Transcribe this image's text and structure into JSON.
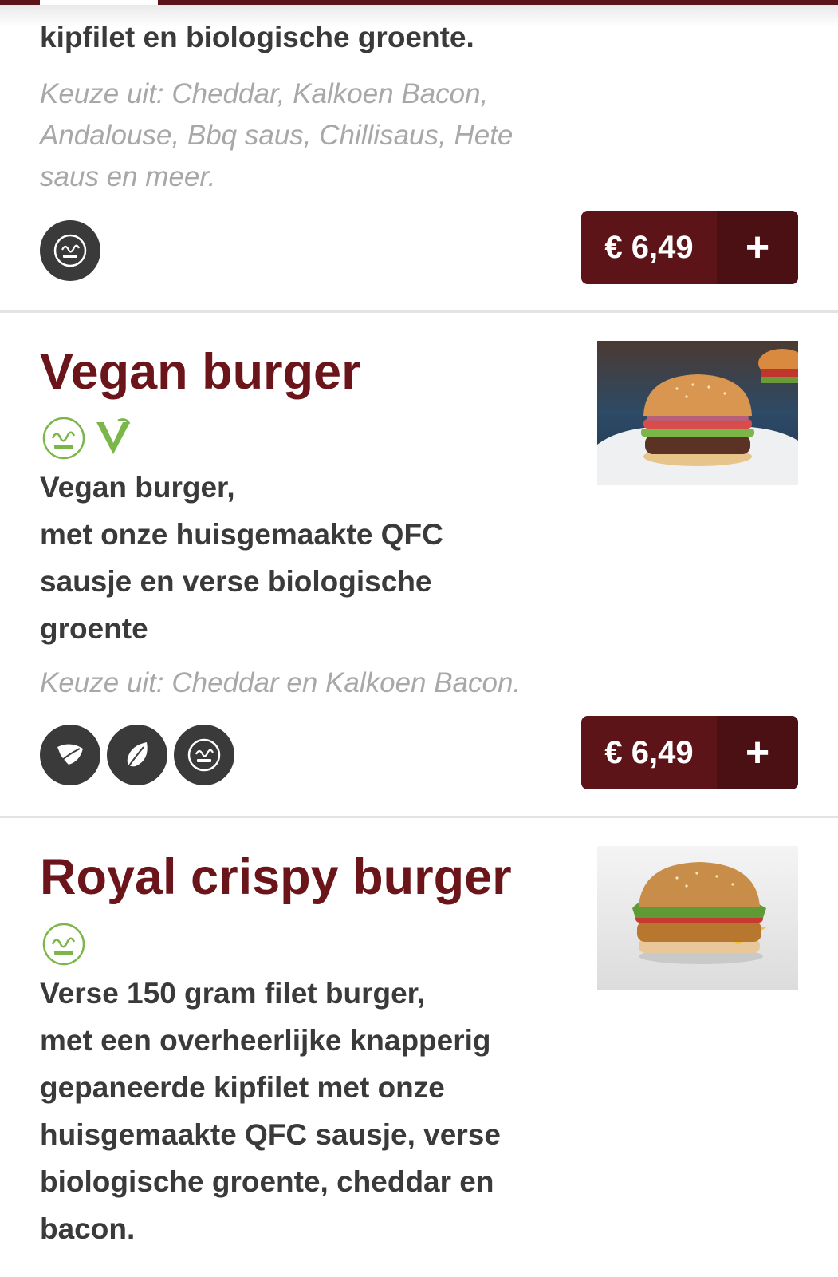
{
  "colors": {
    "brand": "#6b1419",
    "button": "#5c1418",
    "green": "#7ab648"
  },
  "top_item": {
    "description": "kipfilet en biologische groente.",
    "choices": "Keuze uit: Cheddar, Kalkoen Bacon, Andalouse, Bbq saus, Chillisaus, Hete saus en meer.",
    "badges": [
      "halal-icon"
    ],
    "price": "€ 6,49",
    "add_label": "+"
  },
  "items": [
    {
      "title": "Vegan burger",
      "tags": [
        "halal-icon",
        "vegan-icon"
      ],
      "description": [
        "Vegan burger,",
        "met onze huisgemaakte QFC",
        "sausje en verse biologische",
        "groente"
      ],
      "choices": "Keuze uit: Cheddar en Kalkoen Bacon.",
      "badges": [
        "vegetarian-icon",
        "organic-leaf-icon",
        "halal-icon"
      ],
      "price": "€ 6,49",
      "add_label": "+"
    },
    {
      "title": "Royal crispy burger",
      "tags": [
        "halal-icon"
      ],
      "description": [
        "Verse 150 gram filet burger,",
        "met een overheerlijke knapperig",
        "gepaneerde kipfilet met onze",
        "huisgemaakte QFC sausje, verse",
        "biologische groente, cheddar en",
        "bacon."
      ]
    }
  ]
}
